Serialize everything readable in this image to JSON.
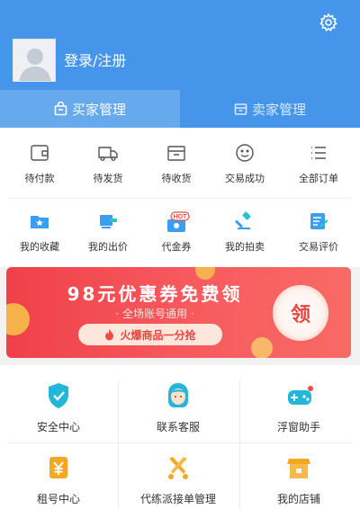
{
  "header": {
    "login_label": "登录/注册",
    "settings_icon": "gear-icon",
    "avatar_icon": "default-avatar"
  },
  "tabs": [
    {
      "label": "买家管理",
      "icon": "bag-icon",
      "active": true
    },
    {
      "label": "卖家管理",
      "icon": "box-icon",
      "active": false
    }
  ],
  "orders": {
    "row1": [
      {
        "label": "待付款",
        "icon": "wallet-icon"
      },
      {
        "label": "待发货",
        "icon": "truck-icon"
      },
      {
        "label": "待收货",
        "icon": "package-icon"
      },
      {
        "label": "交易成功",
        "icon": "smile-icon"
      },
      {
        "label": "全部订单",
        "icon": "list-icon"
      }
    ],
    "row2": [
      {
        "label": "我的收藏",
        "icon": "folder-star-icon"
      },
      {
        "label": "我的出价",
        "icon": "bid-icon"
      },
      {
        "label": "代金券",
        "icon": "coupon-icon",
        "badge": "HOT"
      },
      {
        "label": "我的拍卖",
        "icon": "auction-hammer-icon"
      },
      {
        "label": "交易评价",
        "icon": "review-icon"
      }
    ]
  },
  "banner": {
    "title": "98元优惠券免费领",
    "subtitle": "· 全场账号通用 ·",
    "button_label": "火爆商品一分抢",
    "claim_label": "领"
  },
  "services": [
    {
      "label": "安全中心",
      "icon": "shield-check-icon",
      "color": "#22b7d8"
    },
    {
      "label": "联系客服",
      "icon": "customer-service-icon",
      "color": "#22b7d8"
    },
    {
      "label": "浮窗助手",
      "icon": "gamepad-icon",
      "color": "#22b7d8"
    },
    {
      "label": "租号中心",
      "icon": "yen-tag-icon",
      "color": "#f3a81f"
    },
    {
      "label": "代练派接单管理",
      "icon": "crossed-swords-icon",
      "color": "#f3a81f"
    },
    {
      "label": "我的店铺",
      "icon": "store-icon",
      "color": "#f3a81f"
    }
  ],
  "colors": {
    "header_blue": "#4596ea",
    "banner_red": "#f0404a",
    "service_cyan": "#22b7d8",
    "service_orange": "#f3a81f"
  }
}
